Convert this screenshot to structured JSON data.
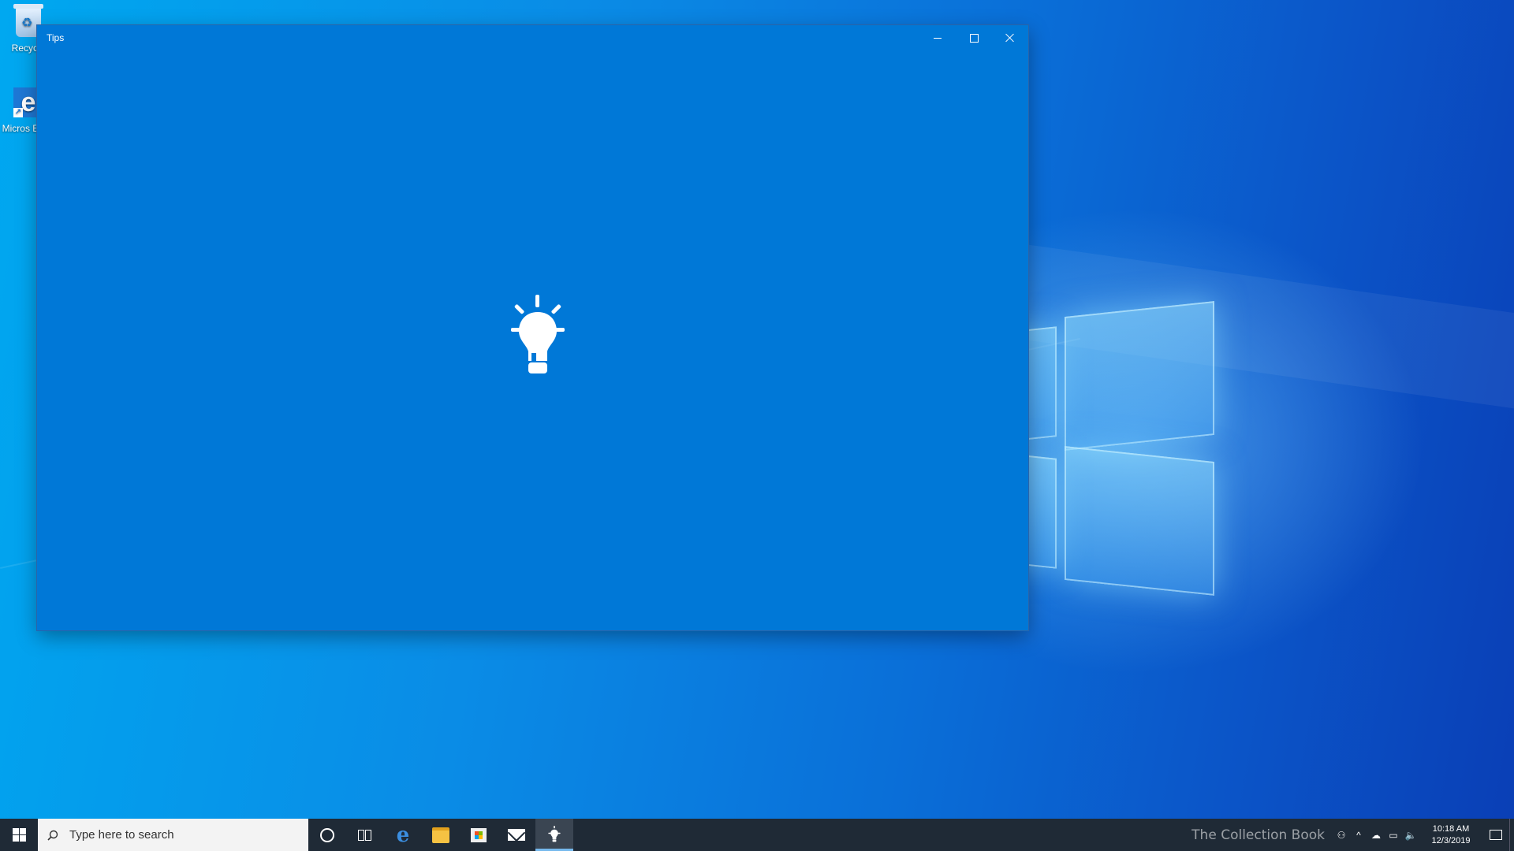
{
  "desktop": {
    "icons": [
      {
        "label": "Recycle",
        "icon": "recycle-bin-icon"
      },
      {
        "label": "Micros Edge",
        "icon": "edge-icon"
      }
    ]
  },
  "window": {
    "title": "Tips",
    "background": "#0078d7",
    "splash_icon": "lightbulb-icon",
    "controls": {
      "minimize": "minimize-icon",
      "maximize": "maximize-icon",
      "close": "close-icon"
    }
  },
  "taskbar": {
    "search_placeholder": "Type here to search",
    "pinned": [
      {
        "name": "cortana",
        "icon": "cortana-icon"
      },
      {
        "name": "task-view",
        "icon": "task-view-icon"
      },
      {
        "name": "edge",
        "icon": "edge-icon"
      },
      {
        "name": "file-explorer",
        "icon": "folder-icon"
      },
      {
        "name": "store",
        "icon": "store-icon"
      },
      {
        "name": "mail",
        "icon": "mail-icon"
      },
      {
        "name": "tips",
        "icon": "lightbulb-icon",
        "active": true
      }
    ],
    "watermark": "The Collection Book",
    "clock": {
      "time": "10:18 AM",
      "date": "12/3/2019"
    },
    "accent": "#76b9ed"
  }
}
